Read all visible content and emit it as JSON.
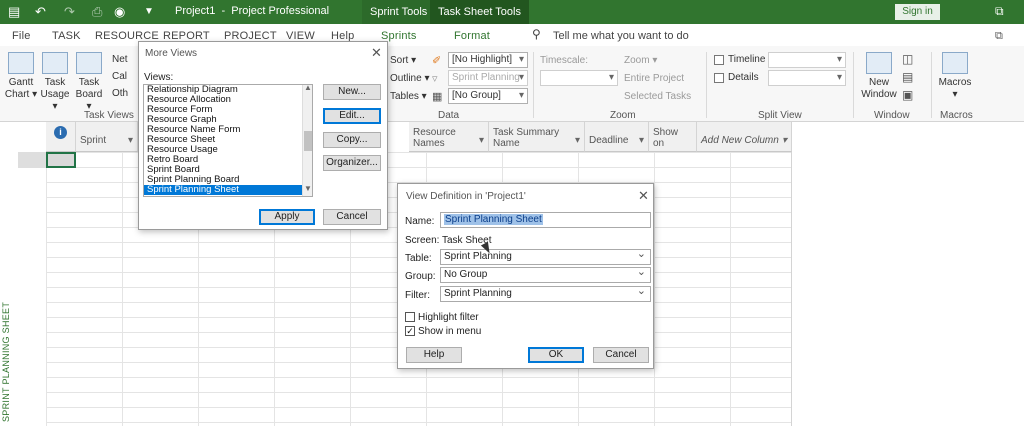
{
  "titlebar": {
    "title": "Project1  -  Project Professional",
    "context_tabs": [
      "Sprint Tools",
      "Task Sheet Tools"
    ],
    "sign_in": "Sign in"
  },
  "menu": {
    "tabs": [
      "File",
      "TASK",
      "RESOURCE",
      "REPORT",
      "PROJECT",
      "VIEW",
      "Help",
      "Sprints",
      "Format"
    ],
    "tell_me": "Tell me what you want to do"
  },
  "ribbon": {
    "gantt_chart": [
      "Gantt",
      "Chart ▾"
    ],
    "task_usage": [
      "Task",
      "Usage ▾"
    ],
    "task_board": [
      "Task",
      "Board ▾"
    ],
    "views_small": [
      "Net",
      "Cal",
      "Oth"
    ],
    "group_task_views": "Task Views",
    "sort": "Sort ▾",
    "outline": "Outline ▾",
    "tables": "Tables ▾",
    "highlight": "[No Highlight]",
    "filter": "Sprint Planning",
    "group_by": "[No Group]",
    "group_data": "Data",
    "timescale": "Timescale:",
    "zoom": "Zoom ▾",
    "entire_project": "Entire Project",
    "selected_tasks": "Selected Tasks",
    "group_zoom": "Zoom",
    "timeline": "Timeline",
    "details": "Details",
    "group_split_view": "Split View",
    "new_window": [
      "New",
      "Window"
    ],
    "group_window": "Window",
    "macros": [
      "Macros",
      "▾"
    ],
    "group_macros": "Macros"
  },
  "sheet": {
    "info_icon": "i",
    "headers": [
      "Sprint",
      "Resource\nNames",
      "Task Summary\nName",
      "Deadline",
      "Show\non",
      "Add New Column"
    ],
    "side_label": "SPRINT PLANNING SHEET"
  },
  "more_views": {
    "title": "More Views",
    "views_label": "Views:",
    "items": [
      "Relationship Diagram",
      "Resource Allocation",
      "Resource Form",
      "Resource Graph",
      "Resource Name Form",
      "Resource Sheet",
      "Resource Usage",
      "Retro Board",
      "Sprint Board",
      "Sprint Planning Board",
      "Sprint Planning Sheet"
    ],
    "selected": "Sprint Planning Sheet",
    "new_btn": "New...",
    "edit_btn": "Edit...",
    "copy_btn": "Copy...",
    "organizer_btn": "Organizer...",
    "apply_btn": "Apply",
    "cancel_btn": "Cancel"
  },
  "view_def": {
    "title": "View Definition in 'Project1'",
    "name_label": "Name:",
    "name_value": "Sprint Planning Sheet",
    "screen_label": "Screen:",
    "screen_value": "Task Sheet",
    "table_label": "Table:",
    "table_value": "Sprint Planning",
    "group_label": "Group:",
    "group_value": "No Group",
    "filter_label": "Filter:",
    "filter_value": "Sprint Planning",
    "highlight_filter": "Highlight filter",
    "highlight_checked": false,
    "show_in_menu": "Show in menu",
    "show_checked": true,
    "help_btn": "Help",
    "ok_btn": "OK",
    "cancel_btn": "Cancel"
  },
  "colors": {
    "accent": "#31752f",
    "selection": "#0078d7"
  }
}
